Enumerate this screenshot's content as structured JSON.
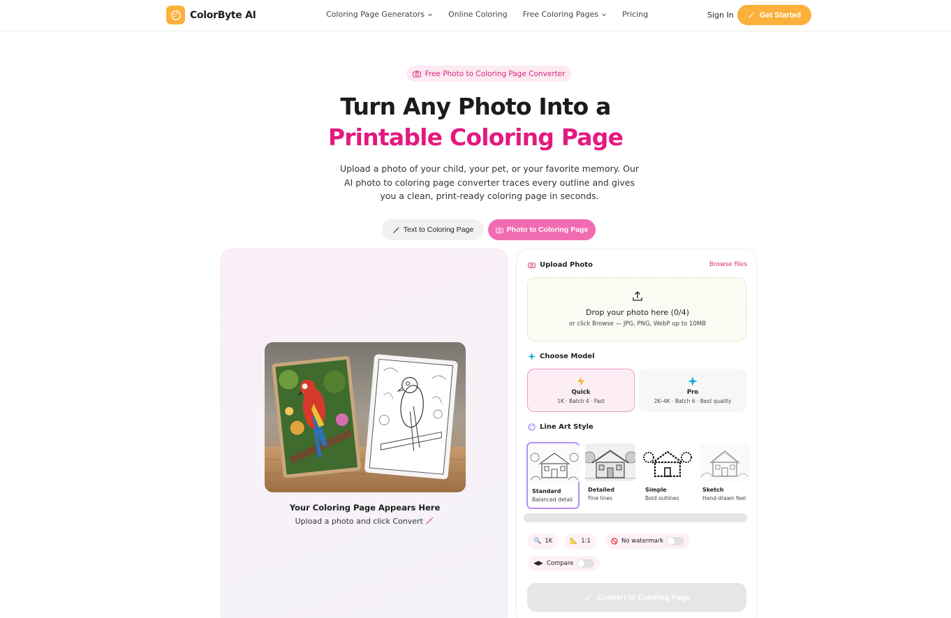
{
  "nav": {
    "brand": "ColorByte AI",
    "links": [
      "Coloring Page Generators",
      "Online Coloring",
      "Free Coloring Pages",
      "Pricing"
    ],
    "sign_in": "Sign In",
    "get_started": "Get Started"
  },
  "hero": {
    "badge": "Free Photo to Coloring Page Converter",
    "title_line1": "Turn Any Photo Into a",
    "title_line2": "Printable Coloring Page",
    "subtitle": "Upload a photo of your child, your pet, or your favorite memory. Our AI photo to coloring page converter traces every outline and gives you a clean, print-ready coloring page in seconds."
  },
  "mode_tabs": {
    "text": "Text to Coloring Page",
    "photo": "Photo to Coloring Page",
    "active": "photo"
  },
  "preview": {
    "title": "Your Coloring Page Appears Here",
    "subtitle": "Upload a photo and click Convert"
  },
  "upload": {
    "label": "Upload Photo",
    "browse": "Browse files",
    "drop_title": "Drop your photo here (0/4)",
    "drop_sub": "or click Browse — JPG, PNG, WebP up to 10MB"
  },
  "model": {
    "label": "Choose Model",
    "options": [
      {
        "name": "Quick",
        "desc": "1K · Batch 4 · Fast",
        "selected": true
      },
      {
        "name": "Pro",
        "desc": "2K–4K · Batch 6 · Best quality",
        "selected": false
      }
    ]
  },
  "line_art": {
    "label": "Line Art Style",
    "styles": [
      {
        "name": "Standard",
        "desc": "Balanced detail",
        "selected": true
      },
      {
        "name": "Detailed",
        "desc": "Fine lines",
        "selected": false
      },
      {
        "name": "Simple",
        "desc": "Bold outlines",
        "selected": false
      },
      {
        "name": "Sketch",
        "desc": "Hand-drawn feel",
        "selected": false
      }
    ]
  },
  "options": {
    "resolution": "1K",
    "aspect": "1:1",
    "no_watermark": "No watermark",
    "compare": "Compare"
  },
  "convert_button": "Convert to Coloring Page",
  "colors": {
    "accent": "#e4197f",
    "brand": "#fbb03b",
    "photo_tab": "#f16bb1"
  }
}
